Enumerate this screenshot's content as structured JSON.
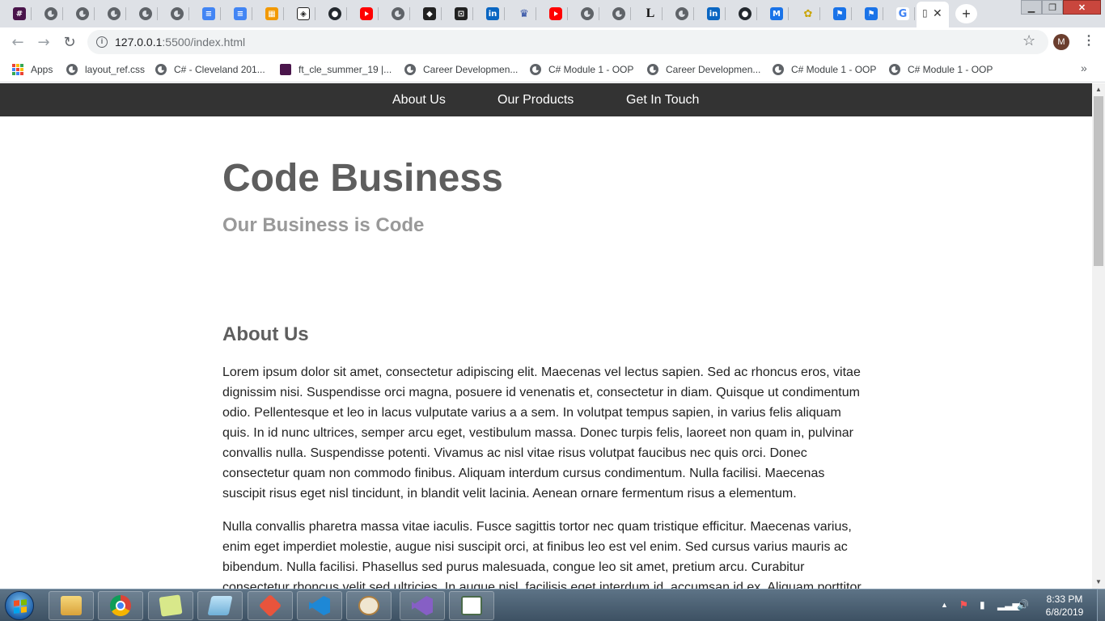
{
  "browser": {
    "tabs": [
      {
        "icon": "slack-icon",
        "glyph": "#"
      },
      {
        "icon": "globe-icon",
        "glyph": ""
      },
      {
        "icon": "globe-icon",
        "glyph": ""
      },
      {
        "icon": "globe-icon",
        "glyph": ""
      },
      {
        "icon": "globe-icon",
        "glyph": ""
      },
      {
        "icon": "globe-icon",
        "glyph": ""
      },
      {
        "icon": "google-docs-icon",
        "glyph": "≡"
      },
      {
        "icon": "google-docs-icon",
        "glyph": "≡"
      },
      {
        "icon": "orange-app-icon",
        "glyph": "▦"
      },
      {
        "icon": "codepen-icon",
        "glyph": "◈"
      },
      {
        "icon": "github-icon",
        "glyph": "●"
      },
      {
        "icon": "youtube-icon",
        "glyph": ""
      },
      {
        "icon": "globe-icon",
        "glyph": ""
      },
      {
        "icon": "dark-app-icon",
        "glyph": "◆"
      },
      {
        "icon": "dark-app-icon",
        "glyph": "⊡"
      },
      {
        "icon": "linkedin-icon",
        "glyph": "in"
      },
      {
        "icon": "crown-icon",
        "glyph": "♛"
      },
      {
        "icon": "youtube-icon",
        "glyph": ""
      },
      {
        "icon": "globe-icon",
        "glyph": ""
      },
      {
        "icon": "globe-icon",
        "glyph": ""
      },
      {
        "icon": "letter-l-icon",
        "glyph": "L"
      },
      {
        "icon": "globe-icon",
        "glyph": ""
      },
      {
        "icon": "linkedin-icon",
        "glyph": "in"
      },
      {
        "icon": "github-icon",
        "glyph": "●"
      },
      {
        "icon": "blue-app-icon",
        "glyph": "M"
      },
      {
        "icon": "bee-icon",
        "glyph": "✿"
      },
      {
        "icon": "flag-icon",
        "glyph": "⚑"
      },
      {
        "icon": "flag-icon",
        "glyph": "⚑"
      },
      {
        "icon": "google-icon",
        "glyph": "G"
      }
    ],
    "active_tab": {
      "icon": "blank-page-icon",
      "glyph": "▯",
      "close_glyph": "✕"
    },
    "new_tab_glyph": "+",
    "window_controls": {
      "minimize": "▁",
      "maximize": "❐",
      "close": "✕"
    },
    "nav": {
      "back": "←",
      "forward": "→",
      "reload": "↻"
    },
    "info_glyph": "i",
    "url_host": "127.0.0.1",
    "url_path": ":5500/index.html",
    "star_glyph": "☆",
    "avatar_letter": "M",
    "menu_glyph": "⋮",
    "bookmarks": [
      {
        "label": "Apps",
        "icon": "apps-icon"
      },
      {
        "label": "layout_ref.css",
        "icon": "globe-icon"
      },
      {
        "label": "C# - Cleveland 201...",
        "icon": "globe-icon"
      },
      {
        "label": "ft_cle_summer_19 |...",
        "icon": "slack-icon"
      },
      {
        "label": "Career Developmen...",
        "icon": "globe-icon"
      },
      {
        "label": "C# Module 1 - OOP",
        "icon": "globe-icon"
      },
      {
        "label": "Career Developmen...",
        "icon": "globe-icon"
      },
      {
        "label": "C# Module 1 - OOP",
        "icon": "globe-icon"
      },
      {
        "label": "C# Module 1 - OOP",
        "icon": "globe-icon"
      }
    ],
    "bookmarks_overflow": "»"
  },
  "page": {
    "nav": {
      "about": "About Us",
      "products": "Our Products",
      "contact": "Get In Touch"
    },
    "title": "Code Business",
    "subtitle": "Our Business is Code",
    "about_heading": "About Us",
    "paragraphs": [
      "Lorem ipsum dolor sit amet, consectetur adipiscing elit. Maecenas vel lectus sapien. Sed ac rhoncus eros, vitae dignissim nisi. Suspendisse orci magna, posuere id venenatis et, consectetur in diam. Quisque ut condimentum odio. Pellentesque et leo in lacus vulputate varius a a sem. In volutpat tempus sapien, in varius felis aliquam quis. In id nunc ultrices, semper arcu eget, vestibulum massa. Donec turpis felis, laoreet non quam in, pulvinar convallis nulla. Suspendisse potenti. Vivamus ac nisl vitae risus volutpat faucibus nec quis orci. Donec consectetur quam non commodo finibus. Aliquam interdum cursus condimentum. Nulla facilisi. Maecenas suscipit risus eget nisl tincidunt, in blandit velit lacinia. Aenean ornare fermentum risus a elementum.",
      "Nulla convallis pharetra massa vitae iaculis. Fusce sagittis tortor nec quam tristique efficitur. Maecenas varius, enim eget imperdiet molestie, augue nisi suscipit orci, at finibus leo est vel enim. Sed cursus varius mauris ac bibendum. Nulla facilisi. Phasellus sed purus malesuada, congue leo sit amet, pretium arcu. Curabitur consectetur rhoncus velit sed ultricies. In augue nisl, facilisis eget interdum id, accumsan id ex. Aliquam porttitor"
    ]
  },
  "scrollbar": {
    "up": "▲",
    "down": "▼",
    "position": 0.0
  },
  "taskbar": {
    "apps": [
      "windows-explorer-icon",
      "chrome-icon",
      "sticky-notes-icon",
      "snipping-tool-icon",
      "git-icon",
      "vscode-icon",
      "paint-icon",
      "visual-studio-icon",
      "window-app-icon"
    ],
    "tray": {
      "arrow": "▲",
      "flag": "⚑",
      "power": "▮",
      "signal": "▂▃▅",
      "volume": "🔊"
    },
    "time": "8:33 PM",
    "date": "6/8/2019"
  },
  "colors": {
    "site_nav_bg": "#333333",
    "heading_gray": "#5e5e5e",
    "subtitle_gray": "#999999",
    "windows_flag": [
      "#f25022",
      "#7fba00",
      "#00a4ef",
      "#ffb900"
    ],
    "apps_grid": [
      "#ea4335",
      "#fbbc04",
      "#34a853",
      "#4285f4",
      "#ea4335",
      "#fbbc04",
      "#34a853",
      "#4285f4",
      "#ea4335"
    ]
  }
}
